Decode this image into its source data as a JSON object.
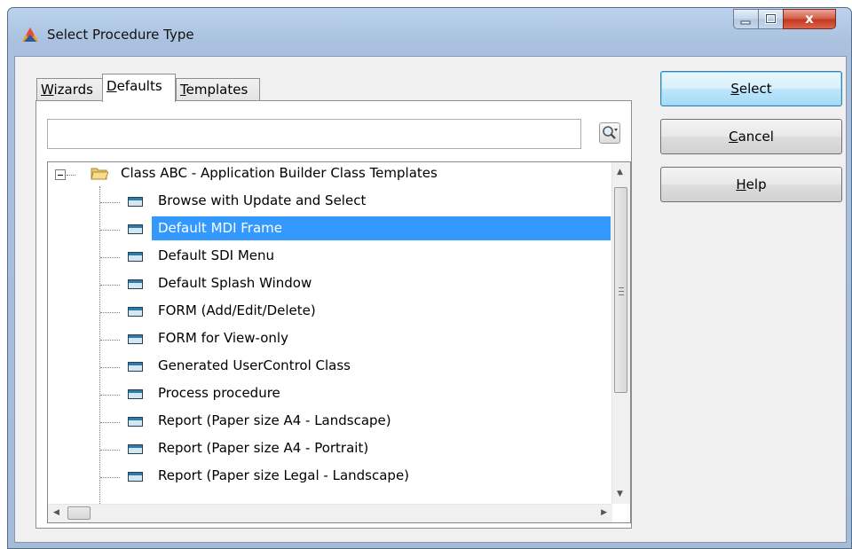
{
  "window": {
    "title": "Select Procedure Type",
    "controls": {
      "minimize_icon": "minimize-icon",
      "maximize_icon": "maximize-icon",
      "close_glyph": "x"
    }
  },
  "tabs": [
    {
      "mnemonic": "W",
      "rest": "izards",
      "active": false
    },
    {
      "mnemonic": "D",
      "rest": "efaults",
      "active": true
    },
    {
      "mnemonic": "T",
      "rest": "emplates",
      "active": false
    }
  ],
  "search": {
    "value": "",
    "placeholder": ""
  },
  "tree": {
    "root": {
      "label": "Class ABC - Application Builder Class Templates",
      "expanded": true
    },
    "items": [
      {
        "label": "Browse with Update and Select",
        "selected": false
      },
      {
        "label": "Default MDI Frame",
        "selected": true
      },
      {
        "label": "Default SDI Menu",
        "selected": false
      },
      {
        "label": "Default Splash Window",
        "selected": false
      },
      {
        "label": "FORM (Add/Edit/Delete)",
        "selected": false
      },
      {
        "label": "FORM for View-only",
        "selected": false
      },
      {
        "label": "Generated UserControl Class",
        "selected": false
      },
      {
        "label": "Process procedure",
        "selected": false
      },
      {
        "label": "Report (Paper size A4 - Landscape)",
        "selected": false
      },
      {
        "label": "Report (Paper size A4 - Portrait)",
        "selected": false
      },
      {
        "label": "Report (Paper size Legal - Landscape)",
        "selected": false
      }
    ]
  },
  "buttons": {
    "select": {
      "mnemonic": "S",
      "rest": "elect"
    },
    "cancel": {
      "mnemonic": "C",
      "rest": "ancel"
    },
    "help": {
      "mnemonic": "H",
      "rest": "elp"
    }
  },
  "colors": {
    "selection": "#3399ff",
    "title_bar": "#bcd2ec",
    "close_button": "#c4371f"
  }
}
